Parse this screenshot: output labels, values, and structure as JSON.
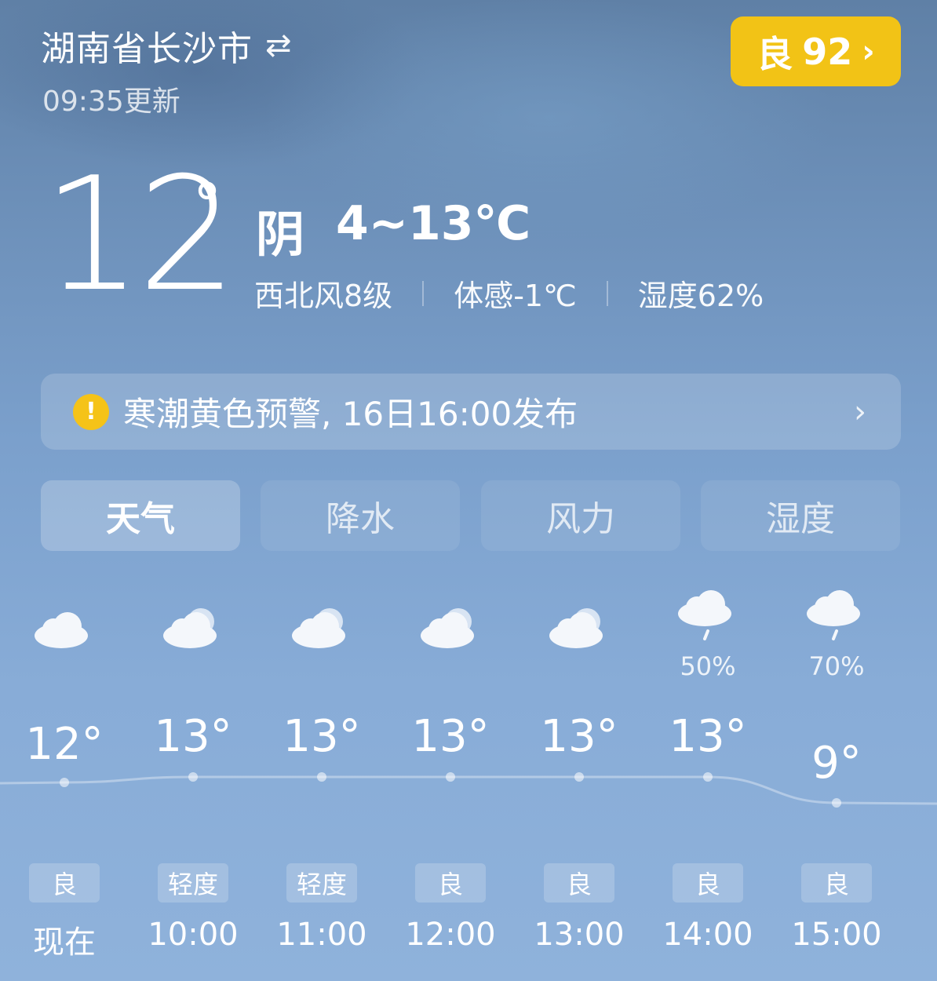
{
  "header": {
    "location": "湖南省长沙市",
    "swap_icon": "⇄",
    "update_time": "09:35更新",
    "aqi_label": "良",
    "aqi_value": "92",
    "aqi_color": "#f2c316"
  },
  "current": {
    "temperature": "12",
    "degree_symbol": "°",
    "condition": "阴",
    "range": "4~13℃",
    "wind": "西北风8级",
    "feels_like": "体感-1℃",
    "humidity": "湿度62%"
  },
  "alert": {
    "icon": "!",
    "text": "寒潮黄色预警, 16日16:00发布",
    "color": "#f5c318"
  },
  "tabs": [
    {
      "label": "天气",
      "active": true
    },
    {
      "label": "降水",
      "active": false
    },
    {
      "label": "风力",
      "active": false
    },
    {
      "label": "湿度",
      "active": false
    }
  ],
  "hourly": [
    {
      "icon": "cloudy-icon",
      "precip": "",
      "temp": "12°",
      "temp_value": 12,
      "aqi": "良",
      "time": "现在"
    },
    {
      "icon": "partly-cloudy-icon",
      "precip": "",
      "temp": "13°",
      "temp_value": 13,
      "aqi": "轻度",
      "time": "10:00"
    },
    {
      "icon": "partly-cloudy-icon",
      "precip": "",
      "temp": "13°",
      "temp_value": 13,
      "aqi": "轻度",
      "time": "11:00"
    },
    {
      "icon": "partly-cloudy-icon",
      "precip": "",
      "temp": "13°",
      "temp_value": 13,
      "aqi": "良",
      "time": "12:00"
    },
    {
      "icon": "partly-cloudy-icon",
      "precip": "",
      "temp": "13°",
      "temp_value": 13,
      "aqi": "良",
      "time": "13:00"
    },
    {
      "icon": "light-rain-icon",
      "precip": "50%",
      "temp": "13°",
      "temp_value": 13,
      "aqi": "良",
      "time": "14:00"
    },
    {
      "icon": "light-rain-icon",
      "precip": "70%",
      "temp": "9°",
      "temp_value": 9,
      "aqi": "良",
      "time": "15:00"
    }
  ]
}
